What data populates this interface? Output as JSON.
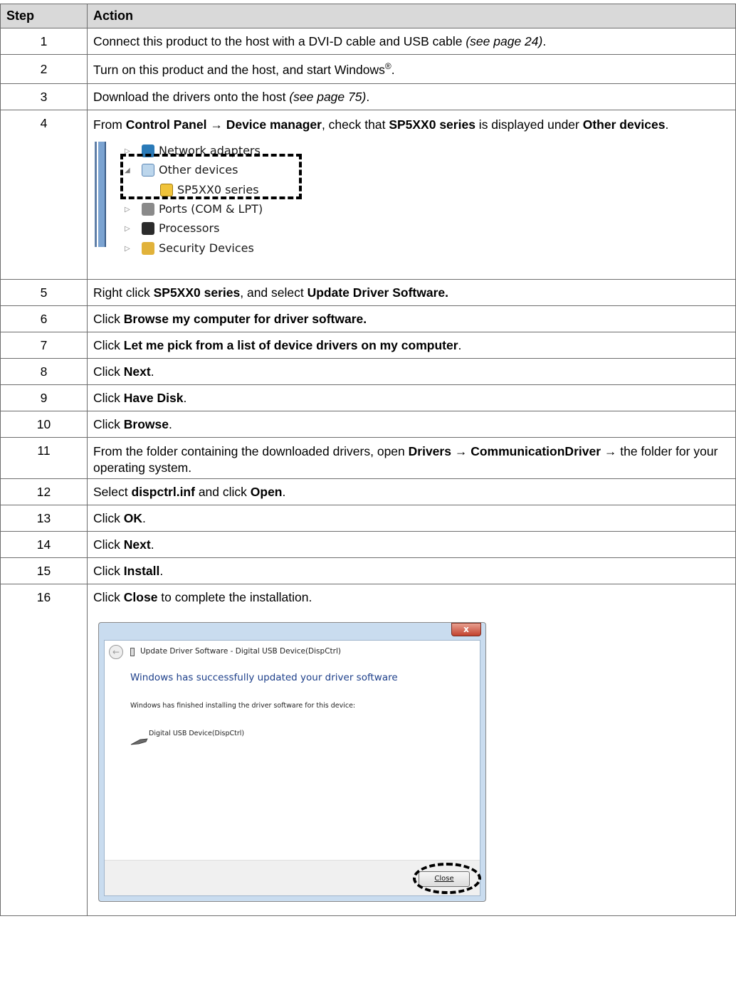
{
  "headers": {
    "step": "Step",
    "action": "Action"
  },
  "steps": [
    {
      "n": "1",
      "pre": "Connect this product to the host with a DVI-D cable and USB cable ",
      "ref": "(see page 24)",
      "post": "."
    },
    {
      "n": "2",
      "text": "Turn on this product and the host, and start Windows",
      "sup": "®",
      "post": "."
    },
    {
      "n": "3",
      "pre": "Download the drivers onto the host ",
      "ref": "(see page 75)",
      "post": "."
    },
    {
      "n": "4",
      "t1": "From ",
      "b1": "Control Panel",
      "t2": " → ",
      "b2": "Device manager",
      "t3": ", check that ",
      "b3": "SP5XX0 series",
      "t4": " is displayed under ",
      "b4": "Other devices",
      "t5": "."
    },
    {
      "n": "5",
      "t1": "Right click ",
      "b1": "SP5XX0 series",
      "t2": ", and select ",
      "b2": "Update Driver Software."
    },
    {
      "n": "6",
      "t1": "Click ",
      "b1": "Browse my computer for driver software."
    },
    {
      "n": "7",
      "t1": "Click ",
      "b1": "Let me pick from a list of device drivers on my computer",
      "t2": "."
    },
    {
      "n": "8",
      "t1": "Click ",
      "b1": "Next",
      "t2": "."
    },
    {
      "n": "9",
      "t1": "Click ",
      "b1": "Have Disk",
      "t2": "."
    },
    {
      "n": "10",
      "t1": "Click ",
      "b1": "Browse",
      "t2": "."
    },
    {
      "n": "11",
      "t1": "From the folder containing the downloaded drivers, open ",
      "b1": "Drivers",
      "t2": " → ",
      "b2": "CommunicationDriver",
      "t3": " → the folder for your operating system."
    },
    {
      "n": "12",
      "t1": "Select ",
      "b1": "dispctrl.inf",
      "t2": " and click ",
      "b2": "Open",
      "t3": "."
    },
    {
      "n": "13",
      "t1": "Click ",
      "b1": "OK",
      "t2": "."
    },
    {
      "n": "14",
      "t1": "Click ",
      "b1": "Next",
      "t2": "."
    },
    {
      "n": "15",
      "t1": "Click ",
      "b1": "Install",
      "t2": "."
    },
    {
      "n": "16",
      "t1": "Click ",
      "b1": "Close",
      "t2": " to complete the installation."
    }
  ],
  "device_manager": {
    "items": [
      "Network adapters",
      "Other devices",
      "SP5XX0 series",
      "Ports (COM & LPT)",
      "Processors",
      "Security Devices"
    ]
  },
  "dialog": {
    "close_x": "x",
    "title": "Update Driver Software - Digital USB Device(DispCtrl)",
    "headline": "Windows has successfully updated your driver software",
    "info": "Windows has finished installing the driver software for this device:",
    "device": "Digital USB Device(DispCtrl)",
    "close_button": "Close"
  }
}
